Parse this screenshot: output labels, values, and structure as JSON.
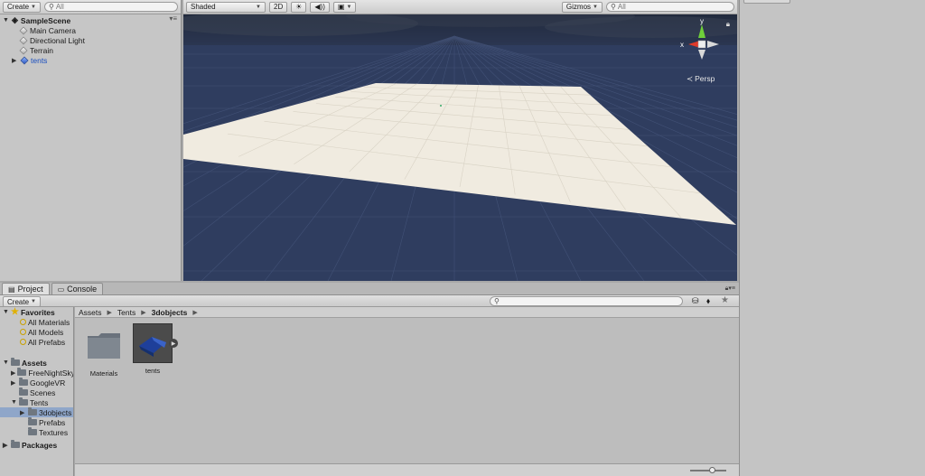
{
  "hierarchy": {
    "create_label": "Create",
    "search_placeholder": "All",
    "scene_name": "SampleScene",
    "items": [
      {
        "label": "Main Camera"
      },
      {
        "label": "Directional Light"
      },
      {
        "label": "Terrain"
      },
      {
        "label": "tents"
      }
    ]
  },
  "scene": {
    "shading_mode": "Shaded",
    "mode_2d": "2D",
    "gizmos_label": "Gizmos",
    "search_placeholder": "All",
    "persp_label": "Persp",
    "axis_y": "y",
    "axis_x": "x"
  },
  "project": {
    "tabs": [
      {
        "label": "Project"
      },
      {
        "label": "Console"
      }
    ],
    "create_label": "Create",
    "favorites": {
      "label": "Favorites",
      "items": [
        {
          "label": "All Materials"
        },
        {
          "label": "All Models"
        },
        {
          "label": "All Prefabs"
        }
      ]
    },
    "assets": {
      "label": "Assets",
      "items": [
        {
          "label": "FreeNightSky"
        },
        {
          "label": "GoogleVR"
        },
        {
          "label": "Scenes"
        },
        {
          "label": "Tents"
        },
        {
          "label": "3dobjects"
        },
        {
          "label": "Prefabs"
        },
        {
          "label": "Textures"
        }
      ]
    },
    "packages_label": "Packages",
    "breadcrumb": [
      "Assets",
      "Tents",
      "3dobjects"
    ],
    "grid": [
      {
        "label": "Materials"
      },
      {
        "label": "tents"
      }
    ]
  },
  "colors": {
    "scene_bg": "#2f3d5f",
    "terrain": "#f0ebe0",
    "selection": "#8fa6c9"
  }
}
